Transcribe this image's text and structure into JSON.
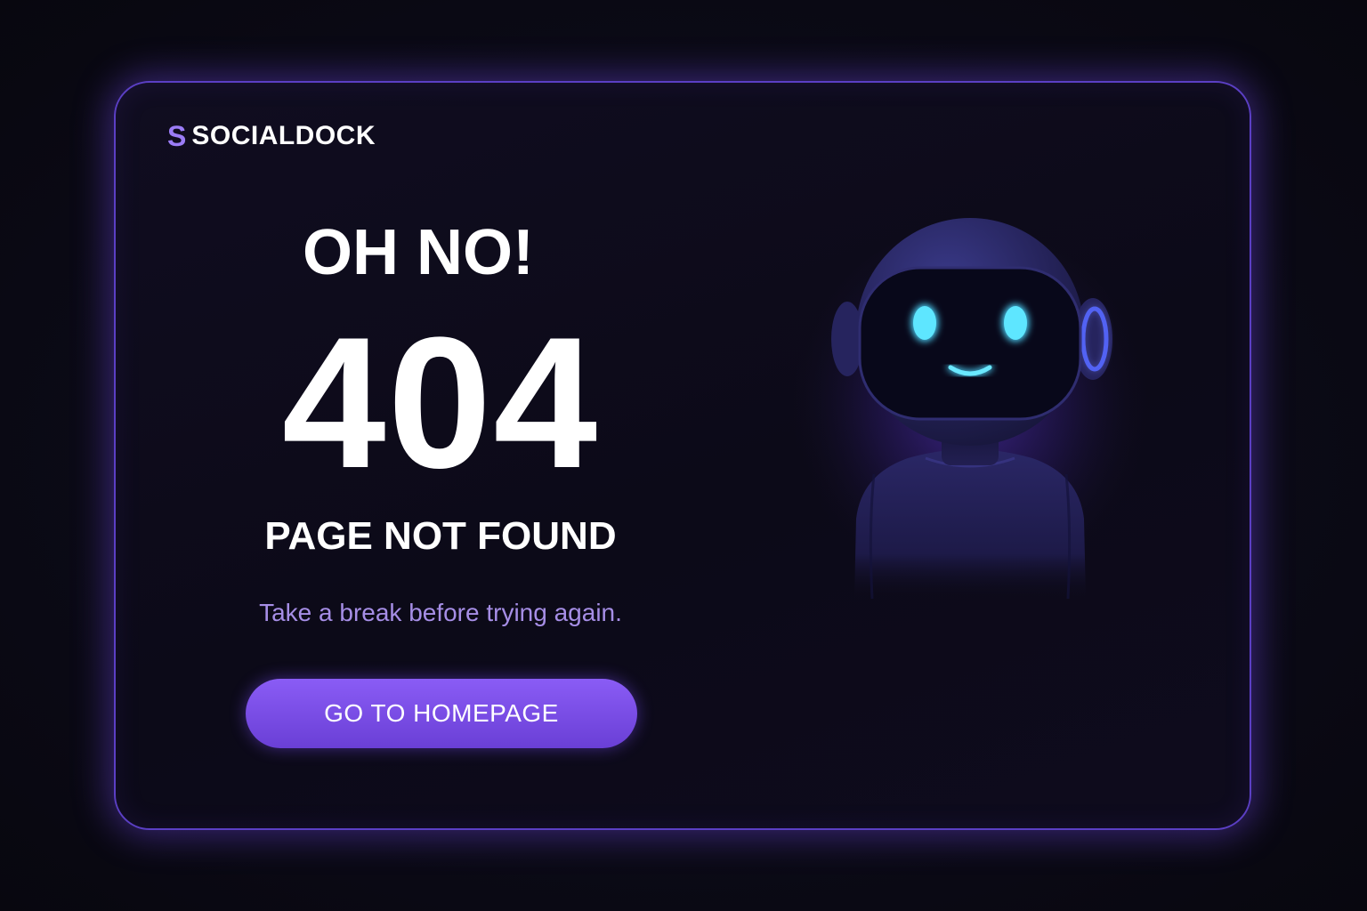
{
  "brand": {
    "mark": "S",
    "name": "SOCIALDOCK"
  },
  "error": {
    "exclamation": "OH NO!",
    "code": "404",
    "message": "PAGE NOT FOUND",
    "tagline": "Take a break before trying again."
  },
  "actions": {
    "home_label": "GO TO HOMEPAGE"
  },
  "illustration": {
    "icon": "robot-mascot-icon"
  },
  "colors": {
    "background": "#0b0a16",
    "accent": "#7c4dff",
    "card_border": "#5b3fc4",
    "tagline": "#a68ee6",
    "robot_eyes": "#4fd8ff"
  }
}
